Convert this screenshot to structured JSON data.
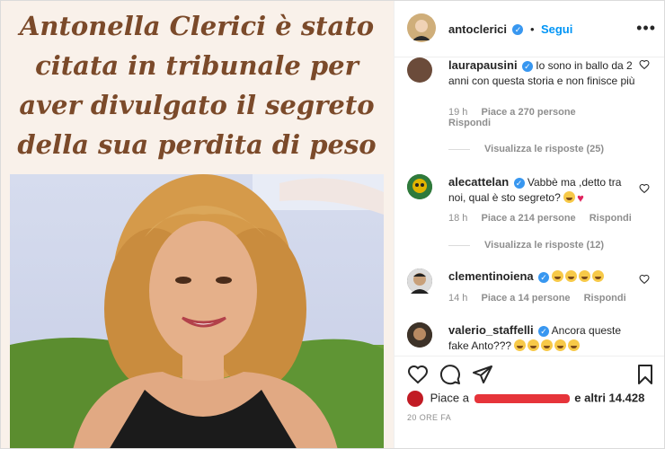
{
  "post": {
    "headline": "Antonella Clerici è stato citata in tribunale per aver divulgato il segreto della sua perdita di peso"
  },
  "header": {
    "username": "antoclerici",
    "follow_label": "Segui",
    "more_label": "•••"
  },
  "comments": [
    {
      "username": "laurapausini",
      "text": "Io sono in ballo da 2 anni con questa storia e non finisce più",
      "time": "19 h",
      "likes": "Piace a 270 persone",
      "reply": "Rispondi",
      "view_replies": "Visualizza le risposte (25)"
    },
    {
      "username": "alecattelan",
      "text": "Vabbè ma ,detto tra noi, qual è sto segreto?",
      "time": "18 h",
      "likes": "Piace a 214 persone",
      "reply": "Rispondi",
      "view_replies": "Visualizza le risposte (12)"
    },
    {
      "username": "clementinoiena",
      "text": "",
      "time": "14 h",
      "likes": "Piace a 14 persone",
      "reply": "Rispondi"
    },
    {
      "username": "valerio_staffelli",
      "text": "Ancora queste fake Anto???"
    }
  ],
  "footer": {
    "likes_prefix": "Piace a",
    "likes_suffix": "e altri 14.428",
    "date": "20 ORE FA"
  },
  "colors": {
    "accent": "#0095f6",
    "headline": "#7b4a2a",
    "post_bg": "#f9f1ea"
  }
}
